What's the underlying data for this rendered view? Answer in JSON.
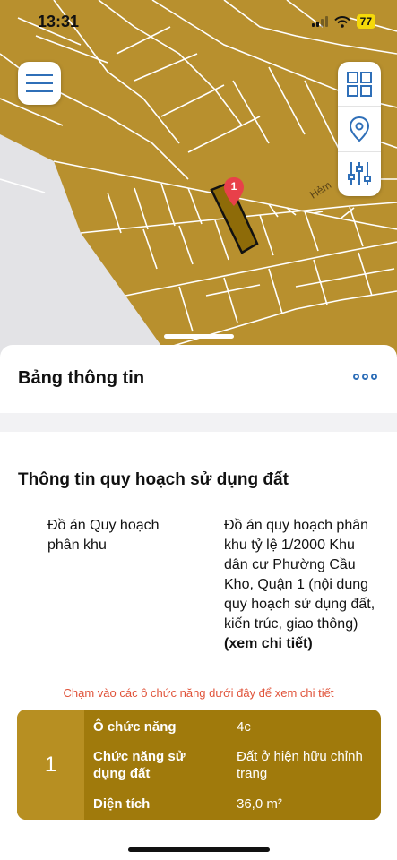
{
  "status_bar": {
    "time": "13:31",
    "battery": "77"
  },
  "map": {
    "street_label": "Hẻm",
    "marker_number": "1"
  },
  "sheet": {
    "title": "Bảng thông tin"
  },
  "land_use": {
    "section_title": "Thông tin quy hoạch sử dụng đất",
    "plan_label": "Đồ án Quy hoạch phân khu",
    "plan_value": "Đồ án quy hoạch phân khu tỷ lệ 1/2000 Khu dân cư Phường Cầu Kho, Quận 1 (nội dung quy hoạch sử dụng đất, kiến trúc, giao thông)",
    "plan_link": "(xem chi tiết)",
    "hint": "Chạm vào các ô chức năng dưới đây để xem chi tiết"
  },
  "function_card": {
    "index": "1",
    "rows": [
      {
        "label": "Ô chức năng",
        "value": "4c"
      },
      {
        "label": "Chức năng sử dụng đất",
        "value": "Đất ở hiện hữu chỉnh trang"
      },
      {
        "label": "Diện tích",
        "value": "36,0 m²"
      }
    ]
  },
  "colors": {
    "map": "#b8902e",
    "card": "#a07a0c",
    "card_index": "#b78f22",
    "accent": "#2f6fb8",
    "hint": "#e0533a",
    "marker": "#e8404a"
  },
  "icons": [
    "menu-icon",
    "grid-icon",
    "location-pin-icon",
    "sliders-icon",
    "more-icon",
    "map-marker-icon"
  ]
}
